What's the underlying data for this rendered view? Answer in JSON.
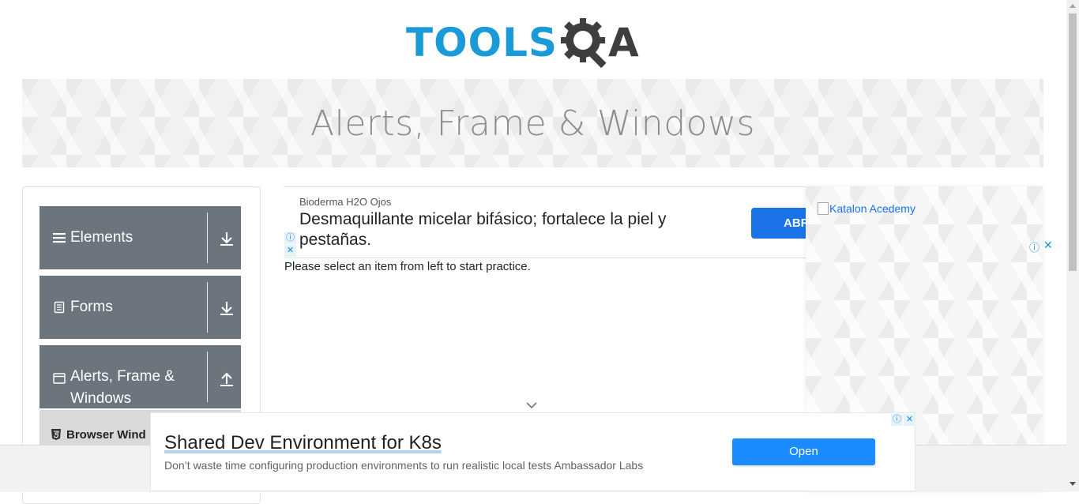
{
  "header": {
    "logo_text_primary": "TOOLS",
    "logo_text_secondary": "A",
    "logo_primary_color": "#1a9ad6",
    "logo_secondary_color": "#3e3e3e"
  },
  "banner": {
    "title": "Alerts, Frame & Windows"
  },
  "sidebar": {
    "groups": [
      {
        "label": "Elements",
        "icon": "hamburger-icon",
        "toggle_icon": "download-arrow-icon"
      },
      {
        "label": "Forms",
        "icon": "document-icon",
        "toggle_icon": "download-arrow-icon"
      },
      {
        "label": "Alerts, Frame & Windows",
        "icon": "window-icon",
        "toggle_icon": "upload-arrow-icon"
      }
    ],
    "active_item": {
      "label": "Browser Wind",
      "icon": "html5-icon"
    }
  },
  "ad_top": {
    "brand": "Bioderma H2O Ojos",
    "headline": "Desmaquillante micelar bifásico; fortalece la piel y pestañas.",
    "cta": "ABR",
    "info_glyph": "ⓘ",
    "close_glyph": "✕"
  },
  "main": {
    "instruction": "Please select an item from left to start practice."
  },
  "right_ad": {
    "image_alt": "Katalon Acedemy",
    "info_glyph": "ⓘ",
    "close_glyph": "✕"
  },
  "bottom_ad": {
    "title": "Shared Dev Environment for K8s",
    "description": "Don’t waste time configuring production environments to run realistic local tests Ambassador Labs",
    "cta": "Open",
    "info_glyph": "ⓘ",
    "close_glyph": "✕"
  },
  "colors": {
    "sidebar_group_bg": "#6c757d",
    "sidebar_active_bg": "#d9d9d9",
    "cta_blue": "#1a8cff",
    "banner_text": "#8d8d8d"
  }
}
